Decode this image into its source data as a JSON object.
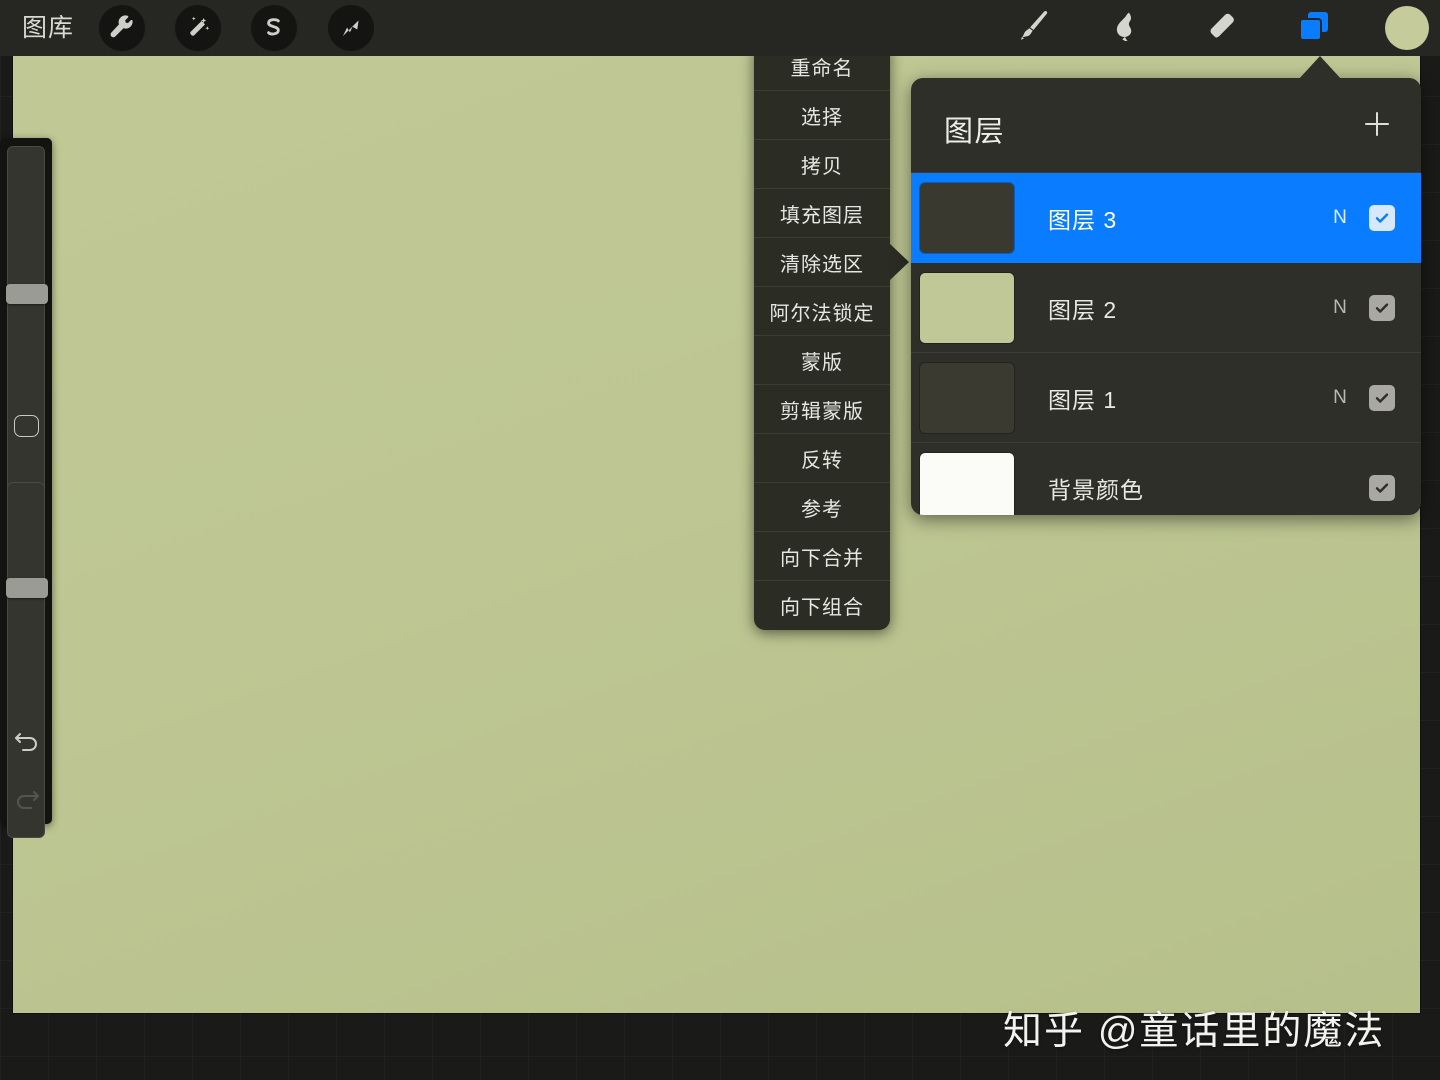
{
  "toolbar": {
    "gallery_label": "图库",
    "left_tools": [
      {
        "name": "wrench-icon",
        "label": "调整工具"
      },
      {
        "name": "magic-wand-icon",
        "label": "调整"
      },
      {
        "name": "selection-s-icon",
        "label": "选取"
      },
      {
        "name": "transform-arrow-icon",
        "label": "变换变形"
      }
    ],
    "right_tools": [
      {
        "name": "paintbrush-icon",
        "label": "绘图"
      },
      {
        "name": "smudge-icon",
        "label": "涂抹"
      },
      {
        "name": "eraser-icon",
        "label": "擦除"
      },
      {
        "name": "layers-icon",
        "label": "图层",
        "active": true
      }
    ],
    "color_swatch": "#c5cb9b"
  },
  "sidebar": {
    "size_slider_label": "笔刷尺寸",
    "opacity_slider_label": "不透明度",
    "modify_button_label": "修改",
    "undo_label": "撤销",
    "redo_label": "重做"
  },
  "canvas": {
    "color": "#bec793"
  },
  "layer_menu": {
    "items": [
      {
        "label": "重命名",
        "pointed": false
      },
      {
        "label": "选择",
        "pointed": false
      },
      {
        "label": "拷贝",
        "pointed": false
      },
      {
        "label": "填充图层",
        "pointed": false
      },
      {
        "label": "清除选区",
        "pointed": true
      },
      {
        "label": "阿尔法锁定",
        "pointed": false
      },
      {
        "label": "蒙版",
        "pointed": false
      },
      {
        "label": "剪辑蒙版",
        "pointed": false
      },
      {
        "label": "反转",
        "pointed": false
      },
      {
        "label": "参考",
        "pointed": false
      },
      {
        "label": "向下合并",
        "pointed": false
      },
      {
        "label": "向下组合",
        "pointed": false
      }
    ]
  },
  "layers_panel": {
    "title": "图层",
    "add_button_label": "+",
    "accent_color": "#0a7cff",
    "rows": [
      {
        "name": "图层 3",
        "blend": "N",
        "visible": true,
        "selected": true,
        "thumb": "#3a392f"
      },
      {
        "name": "图层 2",
        "blend": "N",
        "visible": true,
        "selected": false,
        "thumb": "#bfc896"
      },
      {
        "name": "图层 1",
        "blend": "N",
        "visible": true,
        "selected": false,
        "thumb": "#3a3a30"
      },
      {
        "name": "背景颜色",
        "blend": "",
        "visible": true,
        "selected": false,
        "thumb": "#fbfbf8"
      }
    ]
  },
  "watermark": {
    "text": "知乎 @童话里的魔法"
  }
}
